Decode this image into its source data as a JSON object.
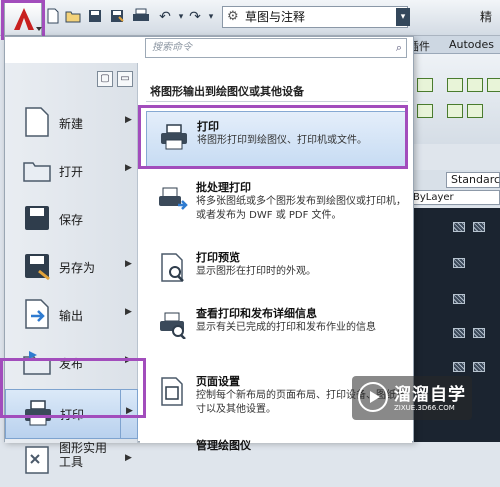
{
  "toolbar": {
    "workspace_value": "草图与注释",
    "window_title_partial": "精"
  },
  "search": {
    "placeholder": "搜索命令"
  },
  "ribbon": {
    "tab_partial_1": "插件",
    "tab_partial_2": "Autodes"
  },
  "properties": {
    "style_value": "Standarc",
    "layer_value": "ByLayer"
  },
  "left_menu": {
    "items": [
      {
        "label": "新建",
        "icon": "new-document-icon",
        "has_submenu": true
      },
      {
        "label": "打开",
        "icon": "open-folder-icon",
        "has_submenu": true
      },
      {
        "label": "保存",
        "icon": "save-disk-icon",
        "has_submenu": false
      },
      {
        "label": "另存为",
        "icon": "save-as-icon",
        "has_submenu": true
      },
      {
        "label": "输出",
        "icon": "export-icon",
        "has_submenu": true
      },
      {
        "label": "发布",
        "icon": "publish-icon",
        "has_submenu": true
      },
      {
        "label": "打印",
        "icon": "printer-icon",
        "has_submenu": true,
        "active": true
      },
      {
        "label": "图形实用工具",
        "icon": "drawing-utilities-icon",
        "has_submenu": true
      }
    ]
  },
  "right_panel": {
    "header": "将图形输出到绘图仪或其他设备",
    "items": [
      {
        "title": "打印",
        "desc": "将图形打印到绘图仪、打印机或文件。",
        "icon": "printer-icon",
        "selected": true
      },
      {
        "title": "批处理打印",
        "desc": "将多张图纸或多个图形发布到绘图仪或打印机，或者发布为 DWF 或 PDF 文件。",
        "icon": "batch-plot-icon"
      },
      {
        "title": "打印预览",
        "desc": "显示图形在打印时的外观。",
        "icon": "plot-preview-icon"
      },
      {
        "title": "查看打印和发布详细信息",
        "desc": "显示有关已完成的打印和发布作业的信息",
        "icon": "plot-details-icon"
      },
      {
        "title": "页面设置",
        "desc": "控制每个新布局的页面布局、打印设备、图纸尺寸以及其他设置。",
        "icon": "page-setup-icon"
      },
      {
        "title": "管理绘图仪",
        "desc": "",
        "icon": "plotter-manager-icon"
      }
    ]
  },
  "watermark": {
    "name": "溜溜自学",
    "url": "ZIXUE.3D66.COM"
  },
  "colors": {
    "highlight_border": "#a24dbc",
    "selection_fill": "#c6dbf3",
    "app_logo_red": "#c8201f"
  }
}
